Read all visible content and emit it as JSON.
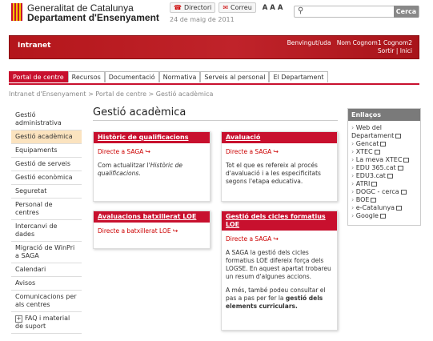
{
  "header": {
    "org_line1": "Generalitat de Catalunya",
    "org_line2": "Departament d'Ensenyament",
    "directori": "Directori",
    "correu": "Correu",
    "font_sizes": "A A A",
    "date": "24 de maig de 2011",
    "search_placeholder": "",
    "search_button": "Cerca"
  },
  "banner": {
    "title": "Intranet",
    "welcome_label": "Benvingut/uda",
    "user_name": "Nom Cognom1 Cognom2",
    "sortir": "Sortir",
    "separator": "|",
    "inici": "Inici"
  },
  "tabs": [
    "Portal de centre",
    "Recursos",
    "Documentació",
    "Normativa",
    "Serveis al personal",
    "El Departament"
  ],
  "breadcrumb": {
    "item1": "Intranet d'Ensenyament",
    "sep": ">",
    "item2": "Portal de centre",
    "item3": "Gestió acadèmica"
  },
  "sidebar": {
    "items": [
      "Gestió administrativa",
      "Gestió acadèmica",
      "Equipaments",
      "Gestió de serveis",
      "Gestió econòmica",
      "Seguretat",
      "Personal de centres",
      "Intercanvi de dades",
      "Migració de WinPri a SAGA",
      "Calendari",
      "Avisos",
      "Comunicacions per als centres",
      "FAQ i material de suport"
    ]
  },
  "main": {
    "title": "Gestió acadèmica",
    "cards": {
      "historic": {
        "title": "Històric de qualificacions",
        "link": "Directe a SAGA",
        "text_pre": "Com actualitzar l'",
        "text_em": "Històric de qualificacions",
        "text_post": "."
      },
      "avaluacio": {
        "title": "Avaluació",
        "link": "Directe a SAGA",
        "text": "Tot el que es refereix al procés d'avaluació i a les especificitats segons l'etapa educativa."
      },
      "batxillerat": {
        "title": "Avaluacions batxillerat LOE",
        "link": "Directe a batxillerat LOE"
      },
      "cicles": {
        "title": "Gestió dels cicles formatius LOE",
        "link": "Directe a SAGA",
        "p1": "A SAGA la gestió dels cicles formatius LOE difereix força dels LOGSE. En aquest apartat trobareu un resum d'algunes accions.",
        "p2_pre": "A més, també podeu consultar el pas a pas per fer la ",
        "p2_bold": "gestió dels elements curriculars."
      }
    }
  },
  "links": {
    "title": "Enllaços",
    "items": [
      "Web del Departament",
      "Gencat",
      "XTEC",
      "La meva XTEC",
      "EDU 365.cat",
      "EDU3.cat",
      "ATRI",
      "DOGC - cerca",
      "BOE",
      "e-Catalunya",
      "Google"
    ]
  },
  "colors": {
    "accent_red": "#c8102e",
    "sidebar_active": "#fbe3bf",
    "links_header": "#7a7a7a"
  },
  "icons": {
    "external_link": "curved-arrow-icon",
    "new_window": "new-window-icon"
  }
}
